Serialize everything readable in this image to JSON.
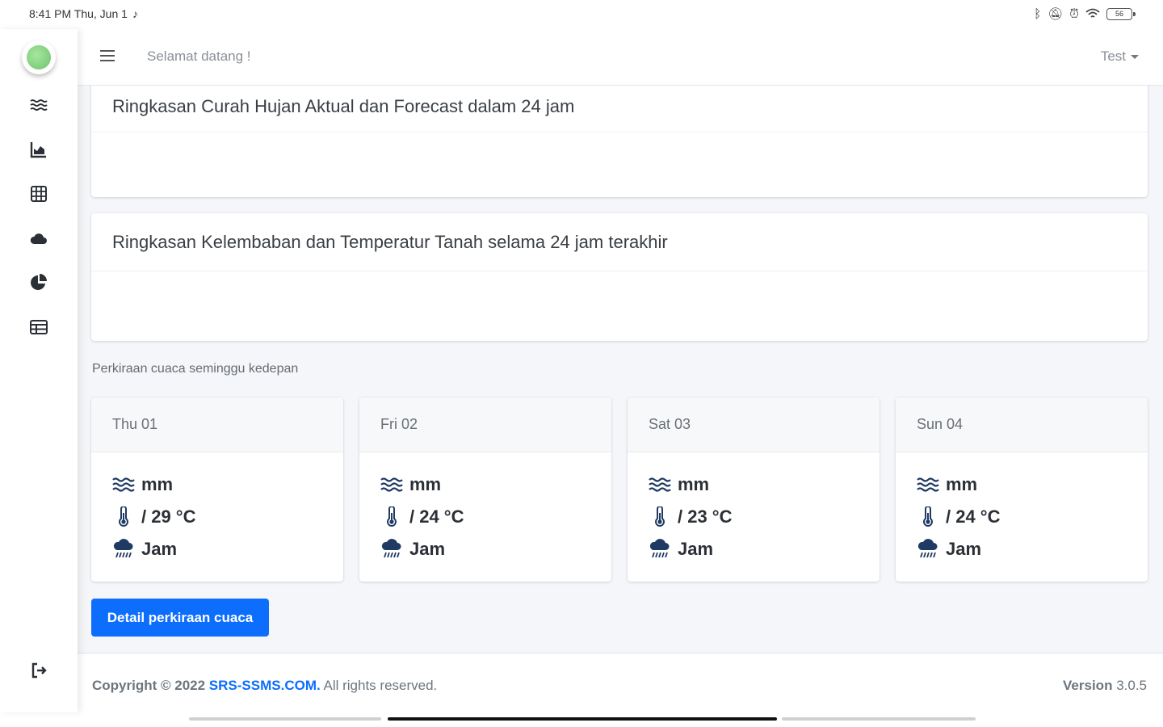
{
  "status_bar": {
    "time_date": "8:41 PM Thu, Jun 1",
    "battery": "56"
  },
  "topbar": {
    "welcome": "Selamat datang !",
    "user": "Test"
  },
  "cards": {
    "rainfall_title": "Ringkasan Curah Hujan Aktual dan Forecast dalam 24 jam",
    "soil_title": "Ringkasan Kelembaban dan Temperatur Tanah selama 24 jam terakhir"
  },
  "forecast": {
    "label": "Perkiraan cuaca seminggu kedepan",
    "days": [
      {
        "day": "Thu 01",
        "rain": "mm",
        "temp": "/ 29 °C",
        "hours": "Jam"
      },
      {
        "day": "Fri 02",
        "rain": "mm",
        "temp": "/ 24 °C",
        "hours": "Jam"
      },
      {
        "day": "Sat 03",
        "rain": "mm",
        "temp": "/ 23 °C",
        "hours": "Jam"
      },
      {
        "day": "Sun 04",
        "rain": "mm",
        "temp": "/ 24 °C",
        "hours": "Jam"
      }
    ],
    "detail_button": "Detail perkiraan cuaca"
  },
  "footer": {
    "copyright_prefix": "Copyright © 2022",
    "site": "SRS-SSMS.COM.",
    "rights": "All rights reserved.",
    "version_label": "Version",
    "version_number": "3.0.5"
  },
  "sidebar": {
    "icons": [
      "water-waves-icon",
      "area-chart-icon",
      "grid-table-icon",
      "cloud-icon",
      "pie-chart-icon",
      "table-icon",
      "logout-icon"
    ]
  },
  "colors": {
    "primary": "#0d6efd",
    "background": "#f4f6f9",
    "icon_dark": "#1f3a63"
  }
}
